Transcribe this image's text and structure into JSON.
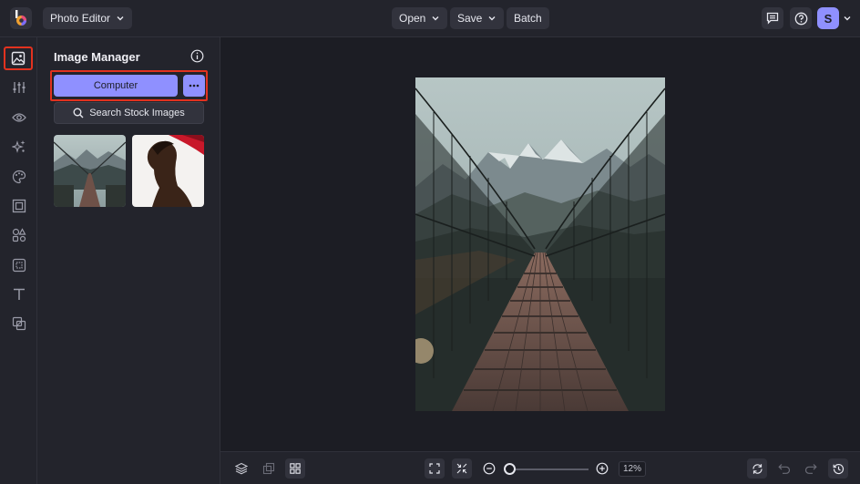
{
  "topbar": {
    "app_menu_label": "Photo Editor",
    "open_label": "Open",
    "save_label": "Save",
    "batch_label": "Batch",
    "avatar_initial": "S"
  },
  "rail": {
    "items": [
      {
        "icon": "image-icon",
        "active": true
      },
      {
        "icon": "adjustments-icon"
      },
      {
        "icon": "eye-icon"
      },
      {
        "icon": "sparkles-icon"
      },
      {
        "icon": "palette-icon"
      },
      {
        "icon": "frame-icon"
      },
      {
        "icon": "shapes-icon"
      },
      {
        "icon": "texture-icon"
      },
      {
        "icon": "text-icon"
      },
      {
        "icon": "overlay-icon"
      }
    ]
  },
  "panel": {
    "title": "Image Manager",
    "computer_label": "Computer",
    "stock_label": "Search Stock Images"
  },
  "bottombar": {
    "zoom_level": "12%",
    "zoom_fraction": 0.02
  },
  "colors": {
    "accent": "#8f90ff",
    "highlight": "#e2321f",
    "background": "#1c1d24",
    "surface": "#23242c"
  }
}
